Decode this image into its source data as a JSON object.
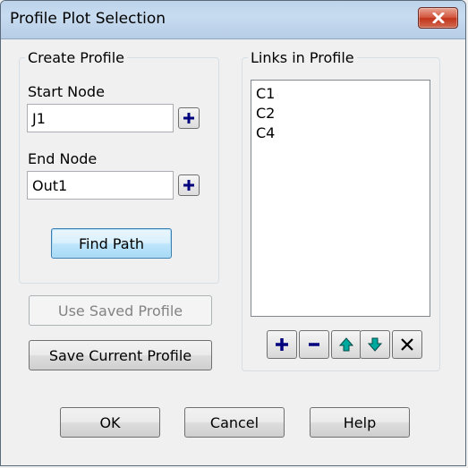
{
  "window": {
    "title": "Profile Plot Selection"
  },
  "create_profile": {
    "legend": "Create Profile",
    "start_node_label": "Start Node",
    "start_node_value": "J1",
    "end_node_label": "End Node",
    "end_node_value": "Out1",
    "find_path_label": "Find Path"
  },
  "links_in_profile": {
    "legend": "Links in Profile",
    "items": [
      "C1",
      "C2",
      "C4"
    ]
  },
  "buttons": {
    "use_saved_profile": "Use Saved Profile",
    "save_current_profile": "Save Current Profile",
    "ok": "OK",
    "cancel": "Cancel",
    "help": "Help"
  },
  "icons": {
    "close": "close-icon",
    "plus": "plus-icon",
    "minus": "minus-icon",
    "arrow_up": "arrow-up-icon",
    "arrow_down": "arrow-down-icon",
    "delete": "delete-icon"
  },
  "colors": {
    "plus_icon": "#00007f",
    "arrow_icon": "#00a99d",
    "default_button_border": "#3c7fb1"
  }
}
